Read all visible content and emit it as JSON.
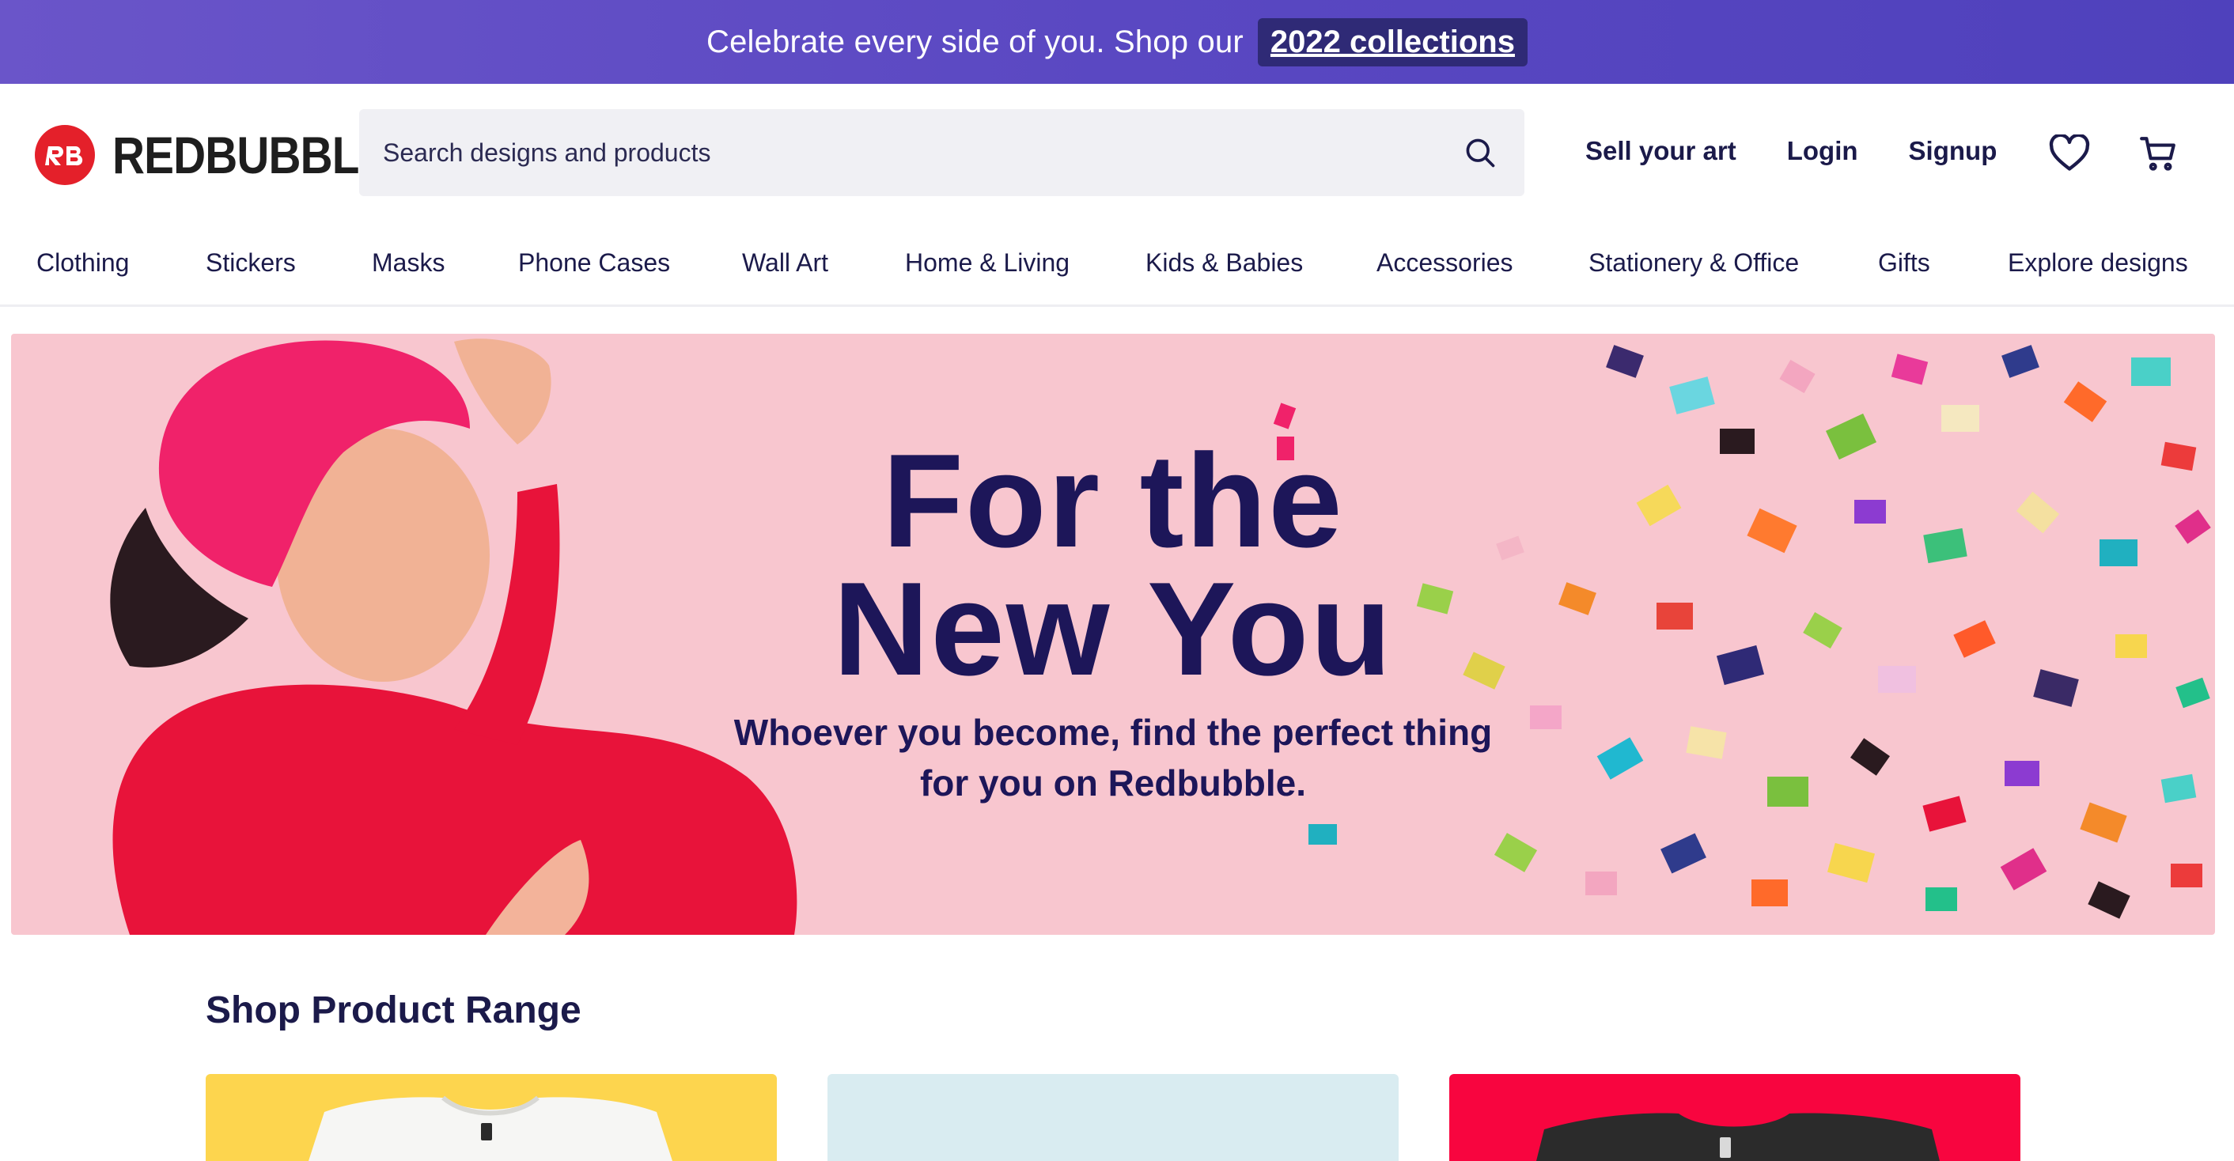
{
  "promo": {
    "text": "Celebrate every side of you. Shop our",
    "link_label": "2022 collections"
  },
  "header": {
    "logo_text": "REDBUBBLE",
    "search_placeholder": "Search designs and products",
    "links": [
      "Sell your art",
      "Login",
      "Signup"
    ],
    "icons": [
      "heart-icon",
      "cart-icon",
      "search-icon"
    ]
  },
  "categories": [
    "Clothing",
    "Stickers",
    "Masks",
    "Phone Cases",
    "Wall Art",
    "Home & Living",
    "Kids & Babies",
    "Accessories",
    "Stationery & Office",
    "Gifts",
    "Explore designs"
  ],
  "hero": {
    "title_line1": "For the",
    "title_line2": "New You",
    "subtitle_line1": "Whoever you become, find the perfect thing",
    "subtitle_line2": "for you on Redbubble."
  },
  "section": {
    "title": "Shop Product Range"
  },
  "colors": {
    "promo_bg": "#5a48c2",
    "brand_red": "#e4202a",
    "text_navy": "#1b1a4a",
    "hero_bg": "#f8c6cf",
    "card_yellow": "#fdd54e",
    "card_lightblue": "#d9ecf1",
    "card_red": "#f8053f"
  }
}
